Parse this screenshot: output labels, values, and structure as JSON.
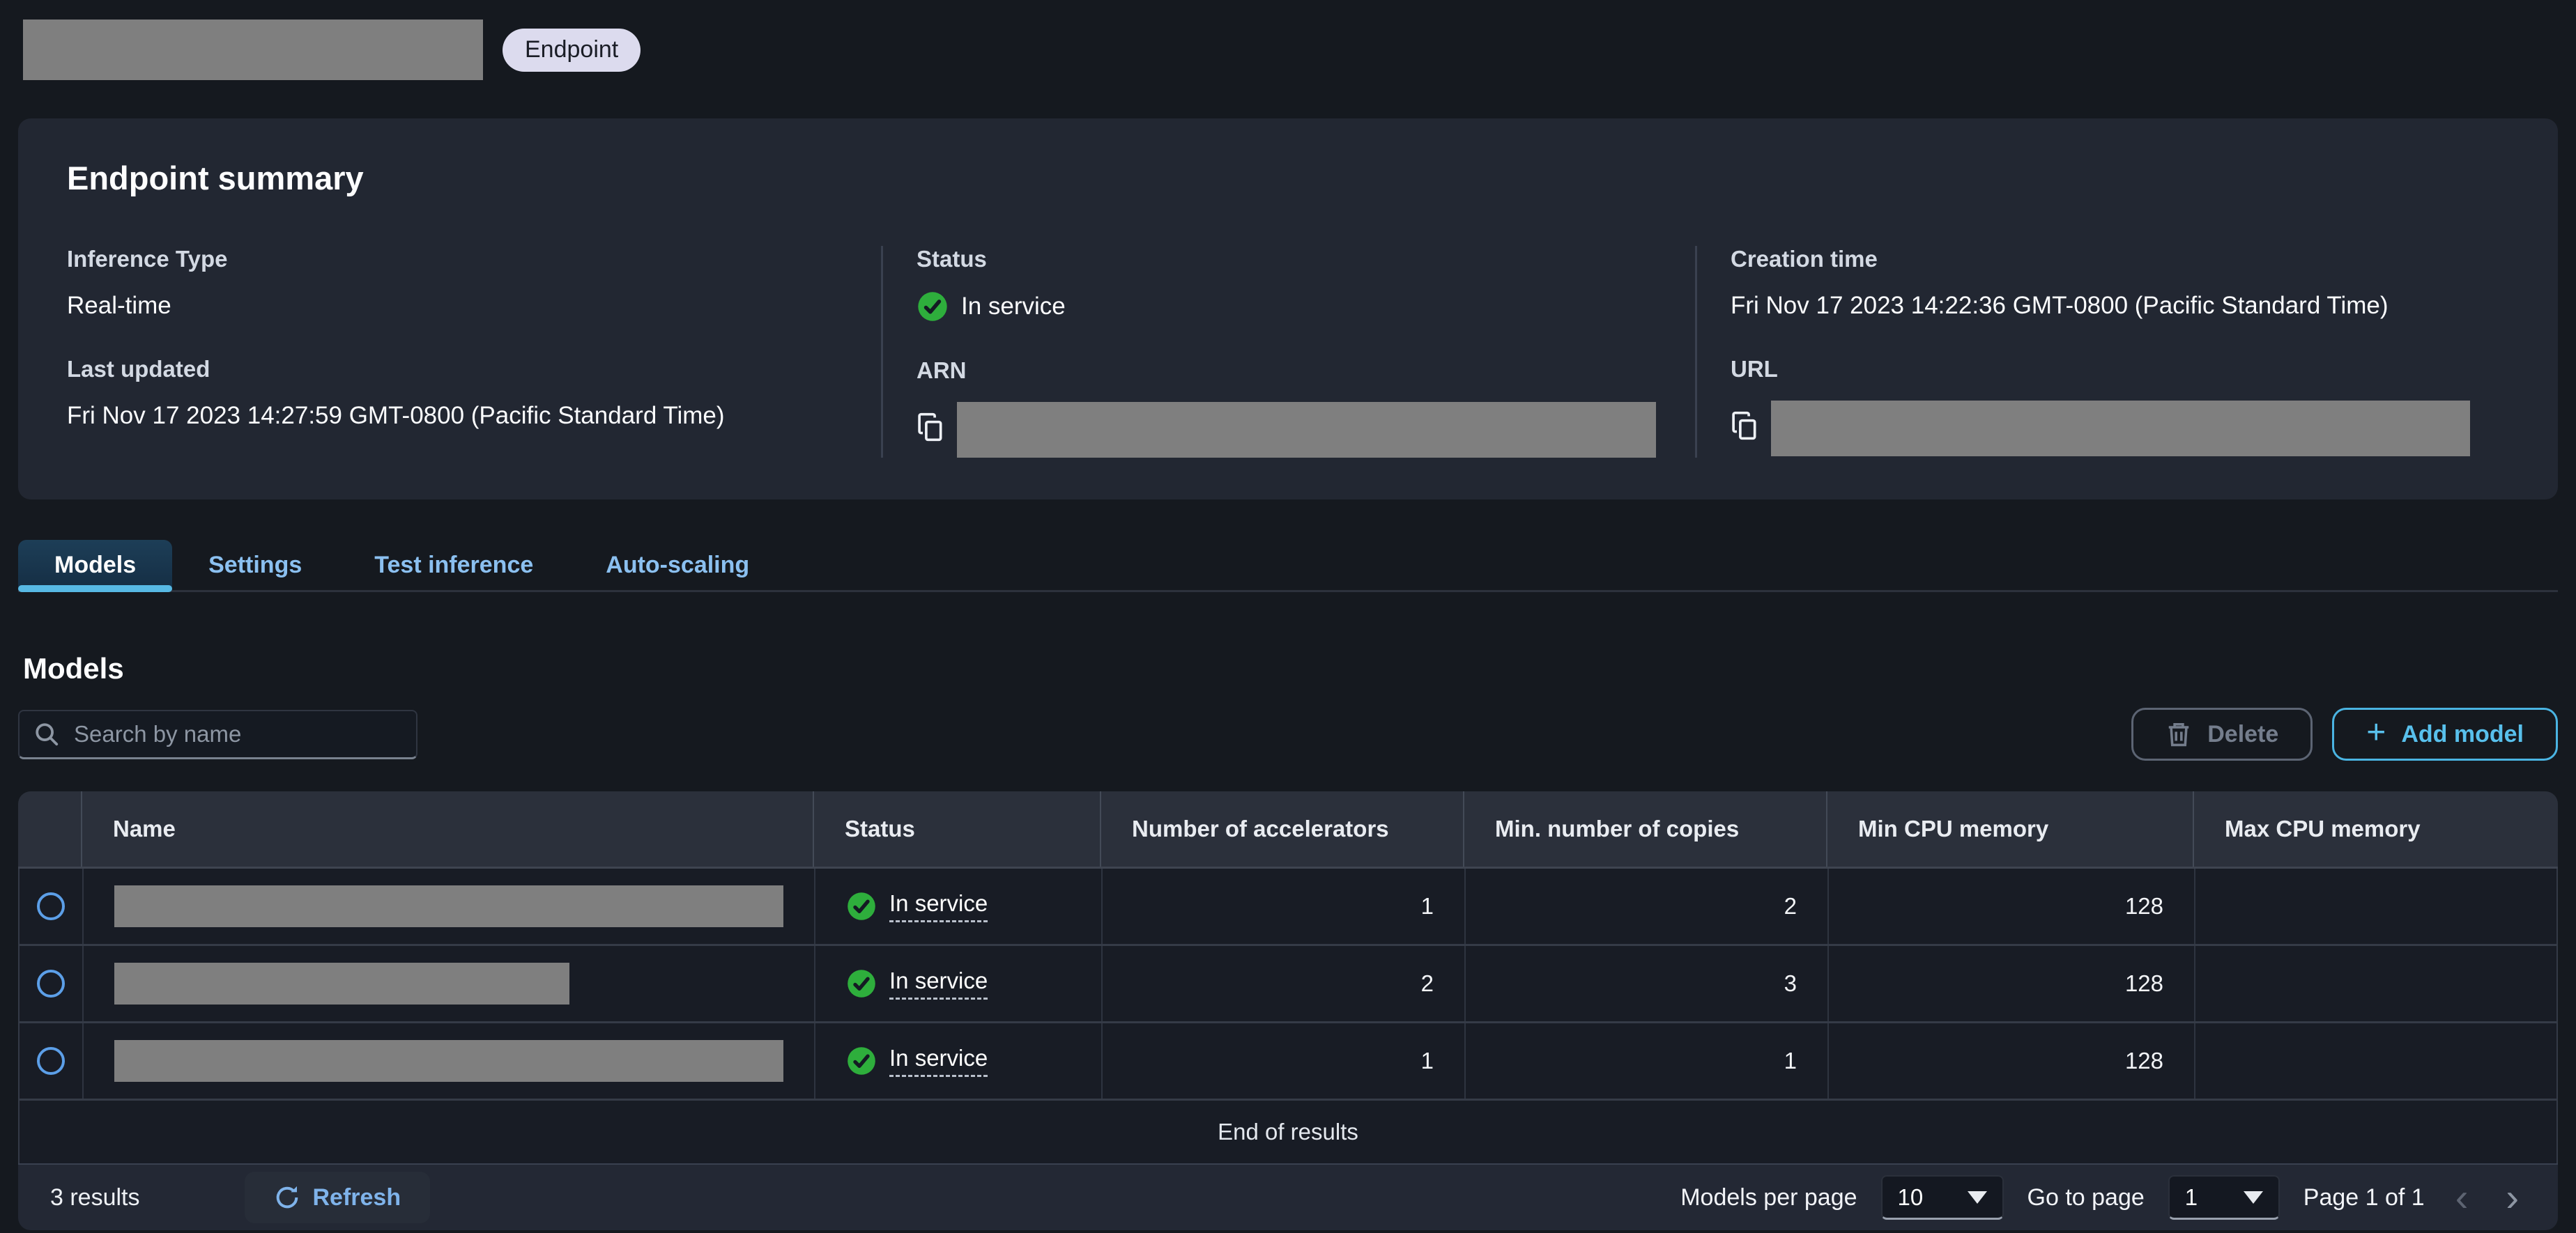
{
  "header": {
    "badge_label": "Endpoint"
  },
  "summary": {
    "title": "Endpoint summary",
    "inference_type_label": "Inference Type",
    "inference_type": "Real-time",
    "status_label": "Status",
    "status": "In service",
    "creation_label": "Creation time",
    "creation": "Fri Nov 17 2023 14:22:36 GMT-0800 (Pacific Standard Time)",
    "updated_label": "Last updated",
    "updated": "Fri Nov 17 2023 14:27:59 GMT-0800 (Pacific Standard Time)",
    "arn_label": "ARN",
    "url_label": "URL"
  },
  "tabs": [
    {
      "label": "Models",
      "active": true
    },
    {
      "label": "Settings",
      "active": false
    },
    {
      "label": "Test inference",
      "active": false
    },
    {
      "label": "Auto-scaling",
      "active": false
    }
  ],
  "models": {
    "heading": "Models",
    "search_placeholder": "Search by name",
    "delete_label": "Delete",
    "add_label": "Add model",
    "table": {
      "columns": [
        "Name",
        "Status",
        "Number of accelerators",
        "Min. number of copies",
        "Min CPU memory",
        "Max CPU memory"
      ],
      "rows": [
        {
          "name_redacted": true,
          "status": "In service",
          "accelerators": "1",
          "min_copies": "2",
          "min_cpu": "128",
          "max_cpu": ""
        },
        {
          "name_redacted": true,
          "status": "In service",
          "accelerators": "2",
          "min_copies": "3",
          "min_cpu": "128",
          "max_cpu": ""
        },
        {
          "name_redacted": true,
          "status": "In service",
          "accelerators": "1",
          "min_copies": "1",
          "min_cpu": "128",
          "max_cpu": ""
        }
      ],
      "end_text": "End of results"
    },
    "footer": {
      "results_text": "3 results",
      "refresh_label": "Refresh",
      "per_page_label": "Models per page",
      "per_page_value": "10",
      "goto_label": "Go to page",
      "goto_value": "1",
      "page_text": "Page 1 of 1",
      "prev_icon": "‹",
      "next_icon": "›"
    }
  },
  "icons": {
    "status_icon": "check-circle",
    "copy_icon": "copy",
    "search_icon": "magnifier",
    "delete_icon": "trash",
    "add_icon": "plus",
    "refresh_icon": "refresh-arrow"
  },
  "colors": {
    "page_bg": "#15191f",
    "panel_bg": "#222732",
    "table_header_bg": "#2b303b",
    "footer_bg": "#232834",
    "status_green": "#2eae3c",
    "tab_link_blue": "#8bc0f0",
    "add_model_cyan": "#58c0ec",
    "active_tab_underline": "#57b9e4",
    "radio_blue": "#5c9fe8",
    "redaction_gray": "#7f7f7f",
    "badge_bg": "#dcdbee"
  }
}
